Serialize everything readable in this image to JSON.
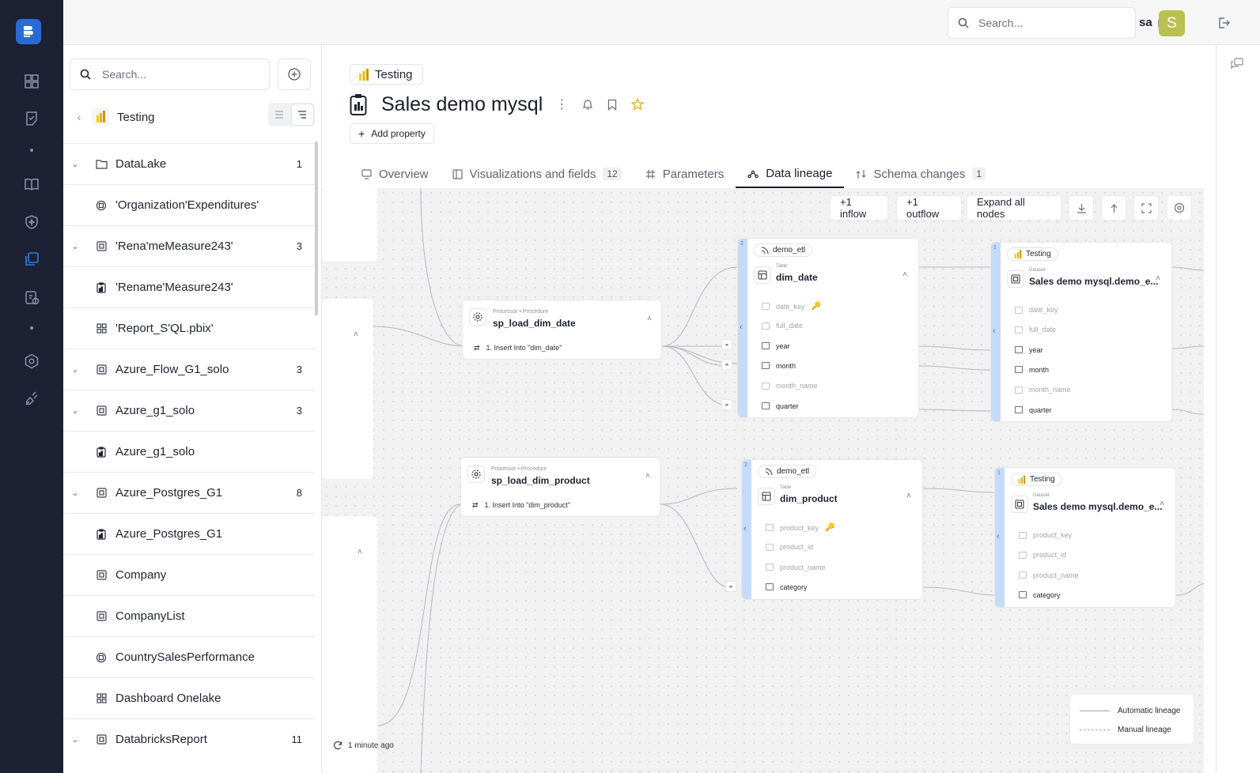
{
  "topbar": {
    "search_placeholder": "Search...",
    "user_name": "sa",
    "avatar_letter": "S"
  },
  "sidebar": {
    "search_placeholder": "Search...",
    "breadcrumb": "Testing",
    "items": [
      {
        "label": "DataLake",
        "count": "1",
        "expandable": true,
        "icon": "folder-icon"
      },
      {
        "label": "'Organization'Expenditures'",
        "count": "",
        "expandable": false,
        "icon": "dataflow-icon"
      },
      {
        "label": "'Rena'meMeasure243'",
        "count": "3",
        "expandable": true,
        "icon": "dataset-icon"
      },
      {
        "label": "'Rename'Measure243'",
        "count": "",
        "expandable": false,
        "icon": "report-icon"
      },
      {
        "label": "'Report_S'QL.pbix'",
        "count": "",
        "expandable": false,
        "icon": "dashboard-icon"
      },
      {
        "label": "Azure_Flow_G1_solo",
        "count": "3",
        "expandable": true,
        "icon": "dataset-icon"
      },
      {
        "label": "Azure_g1_solo",
        "count": "3",
        "expandable": true,
        "icon": "dataset-icon"
      },
      {
        "label": "Azure_g1_solo",
        "count": "",
        "expandable": false,
        "icon": "report-icon"
      },
      {
        "label": "Azure_Postgres_G1",
        "count": "8",
        "expandable": true,
        "icon": "dataset-icon"
      },
      {
        "label": "Azure_Postgres_G1",
        "count": "",
        "expandable": false,
        "icon": "report-icon"
      },
      {
        "label": "Company",
        "count": "",
        "expandable": false,
        "icon": "dataset-icon"
      },
      {
        "label": "CompanyList",
        "count": "",
        "expandable": false,
        "icon": "dataset-icon"
      },
      {
        "label": "CountrySalesPerformance",
        "count": "",
        "expandable": false,
        "icon": "dataflow-icon"
      },
      {
        "label": "Dashboard Onelake",
        "count": "",
        "expandable": false,
        "icon": "dashboard-icon"
      },
      {
        "label": "DatabricksReport",
        "count": "11",
        "expandable": true,
        "icon": "dataset-icon"
      }
    ]
  },
  "page": {
    "breadcrumb": "Testing",
    "title": "Sales demo mysql",
    "add_property": "Add property",
    "tabs": [
      {
        "label": "Overview",
        "badge": ""
      },
      {
        "label": "Visualizations and fields",
        "badge": "12"
      },
      {
        "label": "Parameters",
        "badge": ""
      },
      {
        "label": "Data lineage",
        "badge": ""
      },
      {
        "label": "Schema changes",
        "badge": "1"
      }
    ],
    "active_tab": "Data lineage"
  },
  "lineage": {
    "toolbar": {
      "inflow": "+1 inflow",
      "outflow": "+1 outflow",
      "expand": "Expand all nodes"
    },
    "processors": [
      {
        "kind": "Processor • Procedure",
        "name": "sp_load_dim_date",
        "step": "1. Insert Into \"dim_date\""
      },
      {
        "kind": "Processor • Procedure",
        "name": "sp_load_dim_product",
        "step": "1. Insert Into \"dim_product\""
      }
    ],
    "tables": [
      {
        "count": "2",
        "source": "demo_etl",
        "kind": "Table",
        "name": "dim_date",
        "fields": [
          {
            "name": "date_key",
            "dim": true,
            "key": true
          },
          {
            "name": "full_date",
            "dim": true
          },
          {
            "name": "year",
            "dim": false
          },
          {
            "name": "month",
            "dim": false
          },
          {
            "name": "month_name",
            "dim": true
          },
          {
            "name": "quarter",
            "dim": false
          }
        ]
      },
      {
        "count": "2",
        "source": "demo_etl",
        "kind": "Table",
        "name": "dim_product",
        "fields": [
          {
            "name": "product_key",
            "dim": true,
            "key": true
          },
          {
            "name": "product_id",
            "dim": true
          },
          {
            "name": "product_name",
            "dim": true
          },
          {
            "name": "category",
            "dim": false
          }
        ]
      }
    ],
    "datasets": [
      {
        "count": "1",
        "source": "Testing",
        "kind": "Dataset",
        "name": "Sales demo mysql.demo_e...",
        "fields": [
          {
            "name": "date_key",
            "dim": true
          },
          {
            "name": "full_date",
            "dim": true
          },
          {
            "name": "year",
            "dim": false
          },
          {
            "name": "month",
            "dim": false
          },
          {
            "name": "month_name",
            "dim": true
          },
          {
            "name": "quarter",
            "dim": false
          }
        ]
      },
      {
        "count": "1",
        "source": "Testing",
        "kind": "Dataset",
        "name": "Sales demo mysql.demo_e...",
        "fields": [
          {
            "name": "product_key",
            "dim": true
          },
          {
            "name": "product_id",
            "dim": true
          },
          {
            "name": "product_name",
            "dim": true
          },
          {
            "name": "category",
            "dim": false
          }
        ]
      }
    ],
    "legend": {
      "automatic": "Automatic lineage",
      "manual": "Manual lineage"
    },
    "refreshed": "1 minute ago"
  },
  "colors": {
    "rail": "#1c2233",
    "accent": "#2a6ad6",
    "node_bar": "#c6dbf8",
    "avatar": "#b9c04f"
  }
}
